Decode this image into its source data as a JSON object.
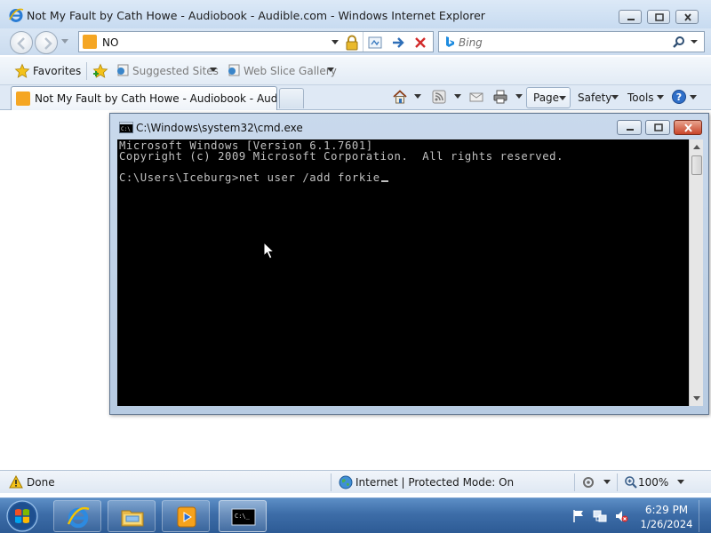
{
  "ie": {
    "window_title": "Not My Fault by Cath Howe - Audiobook - Audible.com - Windows Internet Explorer",
    "address_value": "NO",
    "search_placeholder": "Bing",
    "favorites_label": "Favorites",
    "favorites_items": [
      {
        "label": "Suggested Sites"
      },
      {
        "label": "Web Slice Gallery"
      }
    ],
    "tab_title": "Not My Fault by Cath Howe - Audiobook - Audib...",
    "command_bar": {
      "page_label": "Page",
      "safety_label": "Safety",
      "tools_label": "Tools"
    },
    "status": {
      "text": "Done",
      "zone": "Internet | Protected Mode: On",
      "zoom": "100%"
    }
  },
  "cmd": {
    "title": "C:\\Windows\\system32\\cmd.exe",
    "lines": [
      "Microsoft Windows [Version 6.1.7601]",
      "Copyright (c) 2009 Microsoft Corporation.  All rights reserved.",
      "",
      "C:\\Users\\Iceburg>net user /add forkie"
    ]
  },
  "taskbar": {
    "apps": [
      {
        "icon": "internet-explorer-icon",
        "state": "pinned"
      },
      {
        "icon": "windows-explorer-icon",
        "state": "pinned"
      },
      {
        "icon": "media-player-icon",
        "state": "pinned"
      },
      {
        "icon": "command-prompt-icon",
        "state": "active"
      }
    ],
    "tray_icons": [
      "action-center-flag-icon",
      "network-icon",
      "volume-muted-icon"
    ],
    "clock_time": "6:29 PM",
    "clock_date": "1/26/2024"
  },
  "colors": {
    "console_bg": "#000000",
    "console_text": "#c0c0c0",
    "taskbar": "#3d6da8",
    "close_button": "#c8452a"
  }
}
